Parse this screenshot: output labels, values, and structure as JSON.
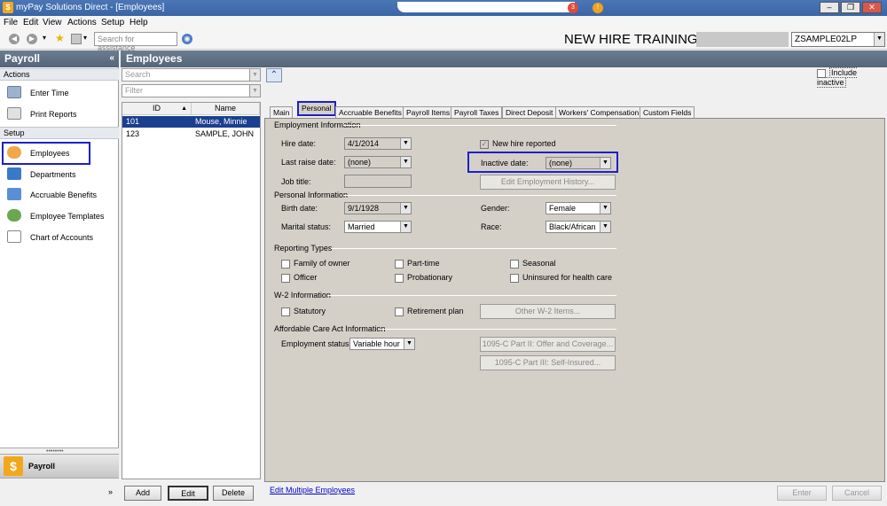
{
  "window": {
    "title": "myPay Solutions Direct - [Employees]",
    "notif_count": "3",
    "notif_warn": "!"
  },
  "menu": [
    "File",
    "Edit",
    "View",
    "Actions",
    "Setup",
    "Help"
  ],
  "toolbar": {
    "search_placeholder": "Search for assistance",
    "banner": "NEW HIRE TRAINING",
    "company": "ZSAMPLE02LP"
  },
  "nav": {
    "header": "Payroll",
    "sections": {
      "actions": "Actions",
      "setup": "Setup"
    },
    "actions": [
      "Enter Time",
      "Print Reports"
    ],
    "setup": [
      "Employees",
      "Departments",
      "Accruable Benefits",
      "Employee Templates",
      "Chart of Accounts"
    ],
    "bottom": "Payroll"
  },
  "panel": {
    "title": "Employees",
    "search_placeholder": "Search",
    "filter_placeholder": "Filter",
    "columns": {
      "id": "ID",
      "name": "Name"
    },
    "rows": [
      {
        "id": "101",
        "name": "Mouse, Minnie",
        "selected": true
      },
      {
        "id": "123",
        "name": "SAMPLE, JOHN",
        "selected": false
      }
    ],
    "buttons": {
      "add": "Add",
      "edit": "Edit",
      "delete": "Delete"
    },
    "include_inactive": "Include inactive"
  },
  "tabs": [
    "Main",
    "Personal",
    "Accruable Benefits",
    "Payroll Items",
    "Payroll Taxes",
    "Direct Deposit",
    "Workers' Compensation",
    "Custom Fields"
  ],
  "active_tab": "Personal",
  "employment": {
    "title": "Employment Information",
    "hire_date_label": "Hire date:",
    "hire_date": "4/1/2014",
    "last_raise_label": "Last raise date:",
    "last_raise": "(none)",
    "job_title_label": "Job title:",
    "job_title": "",
    "new_hire_label": "New hire reported",
    "new_hire_checked": true,
    "inactive_label": "Inactive date:",
    "inactive_date": "(none)",
    "history_button": "Edit Employment History..."
  },
  "personal": {
    "title": "Personal Information",
    "birth_label": "Birth date:",
    "birth_date": "9/1/1928",
    "marital_label": "Marital status:",
    "marital": "Married",
    "gender_label": "Gender:",
    "gender": "Female",
    "race_label": "Race:",
    "race": "Black/African"
  },
  "reporting": {
    "title": "Reporting Types",
    "items": [
      "Family of owner",
      "Part-time",
      "Seasonal",
      "Officer",
      "Probationary",
      "Uninsured for health care"
    ]
  },
  "w2": {
    "title": "W-2 Information",
    "statutory": "Statutory",
    "retirement": "Retirement plan",
    "other_button": "Other W-2 Items..."
  },
  "aca": {
    "title": "Affordable Care Act Information",
    "status_label": "Employment status:",
    "status": "Variable hour",
    "btn_part2": "1095-C Part II: Offer and Coverage...",
    "btn_part3": "1095-C Part III: Self-Insured..."
  },
  "footer": {
    "edit_multiple": "Edit Multiple Employees",
    "enter": "Enter",
    "cancel": "Cancel"
  }
}
